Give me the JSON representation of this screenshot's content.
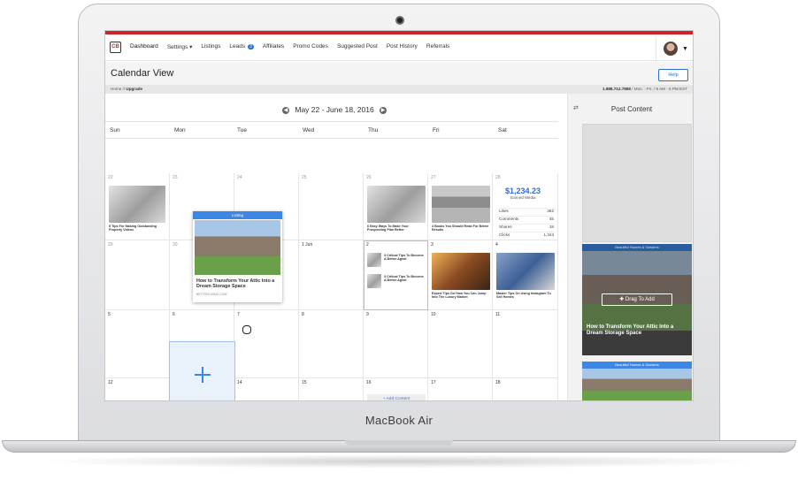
{
  "device": {
    "brand": "MacBook Air"
  },
  "nav": {
    "logo": "CB",
    "items": [
      {
        "label": "Dashboard"
      },
      {
        "label": "Settings ▾"
      },
      {
        "label": "Listings"
      },
      {
        "label": "Leads",
        "badge": "3"
      },
      {
        "label": "Affiliates"
      },
      {
        "label": "Promo Codes"
      },
      {
        "label": "Suggested Post"
      },
      {
        "label": "Post History"
      },
      {
        "label": "Referrals"
      }
    ]
  },
  "page": {
    "title": "Calendar View",
    "help_label": "Help"
  },
  "breadcrumb": {
    "home": "Home",
    "sep": " // ",
    "current": "Upgrade"
  },
  "contact": {
    "phone": "1.888.712.7888",
    "hours": " / Mon. - Fri. / 9 AM - 6 PM EST"
  },
  "calendar": {
    "range": "May 22 - June 18, 2016",
    "days": [
      "Sun",
      "Mon",
      "Tue",
      "Wed",
      "Thu",
      "Fri",
      "Sat"
    ],
    "weeks": [
      [
        "22",
        "23",
        "24",
        "25",
        "26",
        "27",
        "28"
      ],
      [
        "29",
        "30",
        "31",
        "1 Jun",
        "2",
        "3",
        "4"
      ],
      [
        "5",
        "6",
        "7",
        "8",
        "9",
        "10",
        "11"
      ],
      [
        "12",
        "13",
        "14",
        "15",
        "16",
        "17",
        "18"
      ]
    ],
    "posts": {
      "sun22": "5 Tips For Making Outstanding Property Videos",
      "thu26": "6 Easy Ways To Make Your Prospecting Plan Better",
      "fri27": "4 Books You Should Read For Better Results",
      "thu2a": "3 Critical Tips To Become A Better Agent",
      "thu2b": "3 Critical Tips To Become A Better Agent",
      "fri3": "Expert Tips On How You Can Jump Into The Luxury Market",
      "sat4": "Master Tips On Using Instagram To Sell Homes"
    },
    "stats": {
      "amount": "$1,234.23",
      "label": "Earned Media",
      "rows": [
        {
          "label": "Likes",
          "value": "382"
        },
        {
          "label": "Comments",
          "value": "45"
        },
        {
          "label": "Shares",
          "value": "18"
        },
        {
          "label": "Clicks",
          "value": "1,343"
        }
      ]
    },
    "add_content": "+ Add Content",
    "drag_card": {
      "tag": "Listing",
      "title": "How to Transform Your Attic Into a Dream Storage Space",
      "source": "BETTERLIVING.COM"
    }
  },
  "sidebar": {
    "title": "Post Content",
    "card1": {
      "tag": "Beautiful Homes & Gardens",
      "button": "✚ Drag To Add",
      "title": "How to Transform Your Attic Into a Dream Storage Space"
    },
    "card2": {
      "tag": "Beautiful Homes & Gardens"
    }
  }
}
